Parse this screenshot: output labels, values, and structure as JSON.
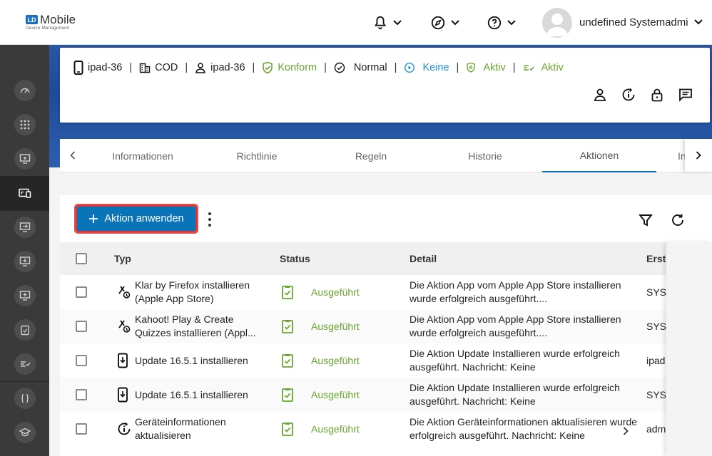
{
  "header": {
    "logo_badge": "LD",
    "logo_text": "Mobile",
    "logo_sub": "Device Management",
    "user_name": "undefined Systemadmi..."
  },
  "device": {
    "name": "ipad-36",
    "ownership": "COD",
    "user": "ipad-36",
    "compliance": "Konform",
    "mode": "Normal",
    "lost_mode": "Keine",
    "security": "Aktiv",
    "management": "Aktiv"
  },
  "tabs": [
    {
      "label": "Informationen"
    },
    {
      "label": "Richtlinie"
    },
    {
      "label": "Regeln"
    },
    {
      "label": "Historie"
    },
    {
      "label": "Aktionen"
    },
    {
      "label": "In"
    }
  ],
  "actions": {
    "apply_label": "Aktion anwenden"
  },
  "table": {
    "columns": {
      "type": "Typ",
      "status": "Status",
      "detail": "Detail",
      "creator": "Erste"
    },
    "rows": [
      {
        "type": "Klar by Firefox installieren (Apple App Store)",
        "status": "Ausgeführt",
        "detail": "Die Aktion App vom Apple App Store installieren wurde erfolgreich ausgeführt....",
        "creator": "SYSTEM"
      },
      {
        "type": "Kahoot! Play & Create Quizzes installieren (Appl...",
        "status": "Ausgeführt",
        "detail": "Die Aktion App vom Apple App Store installieren wurde erfolgreich ausgeführt....",
        "creator": "SYSTEM"
      },
      {
        "type": "Update 16.5.1 installieren",
        "status": "Ausgeführt",
        "detail": "Die Aktion Update Installieren wurde erfolgreich ausgeführt. Nachricht: Keine",
        "creator": "ipad"
      },
      {
        "type": "Update 16.5.1 installieren",
        "status": "Ausgeführt",
        "detail": "Die Aktion Update Installieren wurde erfolgreich ausgeführt. Nachricht: Keine",
        "creator": "SYSTEM"
      },
      {
        "type": "Geräteinformationen aktualisieren",
        "status": "Ausgeführt",
        "detail": "Die Aktion Geräteinformationen aktualisieren wurde erfolgreich ausgeführt. Nachricht: Keine",
        "creator": "admin"
      }
    ]
  },
  "colors": {
    "accent": "#0a74b8",
    "success": "#6aa532",
    "sidebar": "#3a3a3a",
    "banner": "#2b56a4",
    "highlight": "#e14b4b"
  }
}
